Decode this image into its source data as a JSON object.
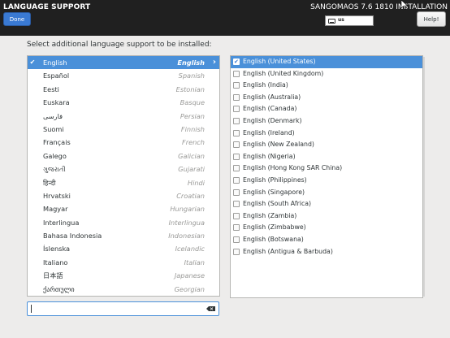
{
  "header": {
    "title": "LANGUAGE SUPPORT",
    "done_label": "Done",
    "install_title": "SANGOMAOS 7.6 1810 INSTALLATION",
    "keyboard_layout": "us",
    "help_label": "Help!"
  },
  "main": {
    "prompt": "Select additional language support to be installed:"
  },
  "languages": [
    {
      "native": "English",
      "english": "English",
      "selected": true
    },
    {
      "native": "Español",
      "english": "Spanish"
    },
    {
      "native": "Eesti",
      "english": "Estonian"
    },
    {
      "native": "Euskara",
      "english": "Basque"
    },
    {
      "native": "فارسی",
      "english": "Persian"
    },
    {
      "native": "Suomi",
      "english": "Finnish"
    },
    {
      "native": "Français",
      "english": "French"
    },
    {
      "native": "Galego",
      "english": "Galician"
    },
    {
      "native": "ગુજરાતી",
      "english": "Gujarati"
    },
    {
      "native": "हिन्दी",
      "english": "Hindi"
    },
    {
      "native": "Hrvatski",
      "english": "Croatian"
    },
    {
      "native": "Magyar",
      "english": "Hungarian"
    },
    {
      "native": "Interlingua",
      "english": "Interlingua"
    },
    {
      "native": "Bahasa Indonesia",
      "english": "Indonesian"
    },
    {
      "native": "Íslenska",
      "english": "Icelandic"
    },
    {
      "native": "Italiano",
      "english": "Italian"
    },
    {
      "native": "日本語",
      "english": "Japanese"
    },
    {
      "native": "ქართული",
      "english": "Georgian"
    }
  ],
  "locales": [
    {
      "label": "English (United States)",
      "checked": true
    },
    {
      "label": "English (United Kingdom)",
      "checked": false
    },
    {
      "label": "English (India)",
      "checked": false
    },
    {
      "label": "English (Australia)",
      "checked": false
    },
    {
      "label": "English (Canada)",
      "checked": false
    },
    {
      "label": "English (Denmark)",
      "checked": false
    },
    {
      "label": "English (Ireland)",
      "checked": false
    },
    {
      "label": "English (New Zealand)",
      "checked": false
    },
    {
      "label": "English (Nigeria)",
      "checked": false
    },
    {
      "label": "English (Hong Kong SAR China)",
      "checked": false
    },
    {
      "label": "English (Philippines)",
      "checked": false
    },
    {
      "label": "English (Singapore)",
      "checked": false
    },
    {
      "label": "English (South Africa)",
      "checked": false
    },
    {
      "label": "English (Zambia)",
      "checked": false
    },
    {
      "label": "English (Zimbabwe)",
      "checked": false
    },
    {
      "label": "English (Botswana)",
      "checked": false
    },
    {
      "label": "English (Antigua & Barbuda)",
      "checked": false
    }
  ],
  "search": {
    "value": ""
  },
  "icons": {
    "selected_check": "checkmark-icon",
    "expand_arrow": "chevron-right-icon",
    "keyboard": "keyboard-icon",
    "clear": "clear-text-icon"
  },
  "colors": {
    "header_bg": "#202020",
    "accent": "#4a90d9",
    "done_button": "#3a7ad3",
    "window_bg": "#edeceb"
  }
}
